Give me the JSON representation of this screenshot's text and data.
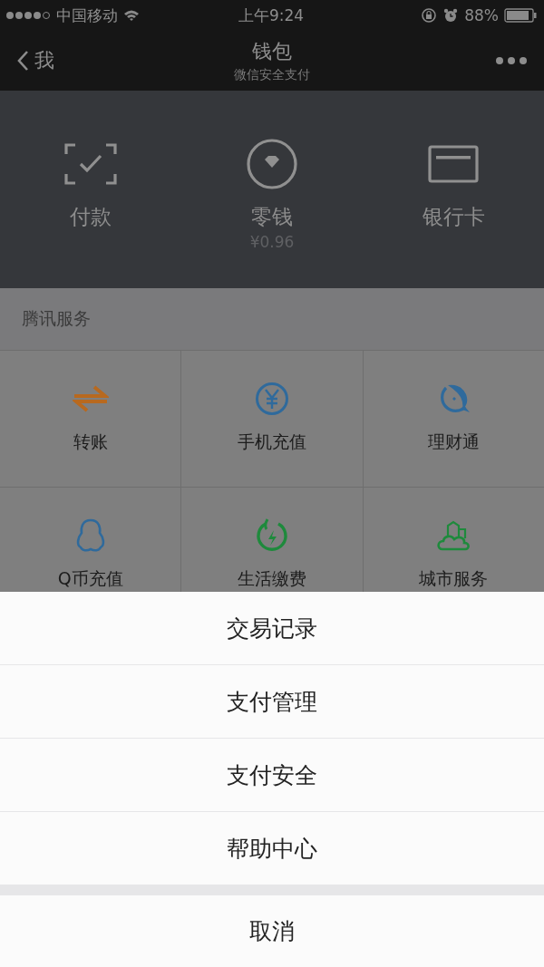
{
  "status_bar": {
    "carrier": "中国移动",
    "time": "上午9:24",
    "battery_text": "88%"
  },
  "nav": {
    "back": "我",
    "title": "钱包",
    "subtitle": "微信安全支付"
  },
  "wallet": [
    {
      "kind": "pay",
      "label": "付款"
    },
    {
      "kind": "change",
      "label": "零钱",
      "amount": "¥0.96"
    },
    {
      "kind": "card",
      "label": "银行卡"
    }
  ],
  "section": {
    "title": "腾讯服务"
  },
  "services": [
    {
      "kind": "transfer",
      "label": "转账",
      "color": "#b8691f"
    },
    {
      "kind": "yuan",
      "label": "手机充值",
      "color": "#2f6a9c"
    },
    {
      "kind": "fish",
      "label": "理财通",
      "color": "#2f6a9c"
    },
    {
      "kind": "penguin",
      "label": "Q币充值",
      "color": "#2f6a9c"
    },
    {
      "kind": "power",
      "label": "生活缴费",
      "color": "#1e8a3c"
    },
    {
      "kind": "city",
      "label": "城市服务",
      "color": "#1e8a3c"
    }
  ],
  "action_sheet": {
    "items": [
      "交易记录",
      "支付管理",
      "支付安全",
      "帮助中心"
    ],
    "cancel": "取消"
  }
}
